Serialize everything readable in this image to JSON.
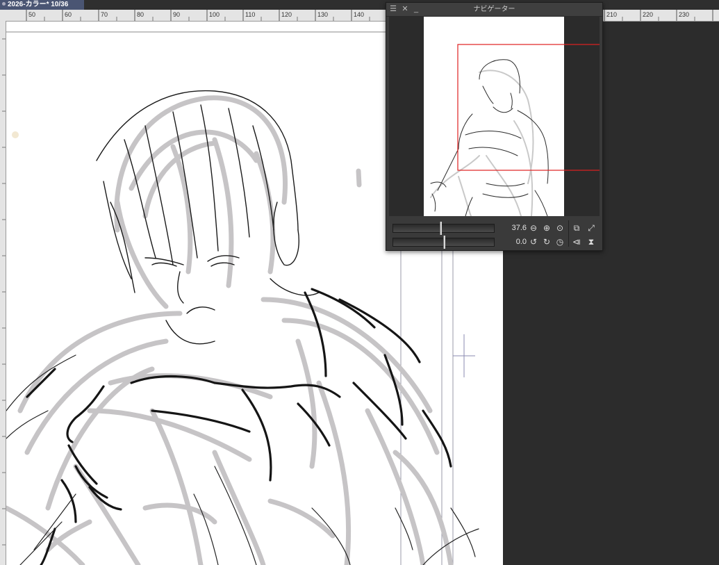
{
  "document_tab": {
    "title": "2026-カラー* 10/36"
  },
  "ruler": {
    "labels": [
      "50",
      "60",
      "70",
      "80",
      "90",
      "100",
      "110",
      "120",
      "130",
      "140",
      "210",
      "220",
      "230"
    ]
  },
  "navigator": {
    "title": "ナビゲーター",
    "zoom_value": "37.6",
    "rotation_value": "0.0",
    "zoom_level": 0.47,
    "rotation_level": 0.5,
    "colors": {
      "view_frame": "#e02020",
      "panel_bg": "#3a3a3a"
    },
    "icons": {
      "menu": "menu-icon",
      "close": "close-icon",
      "minimize": "minimize-icon",
      "zoom_out": "zoom-out-icon",
      "zoom_in": "zoom-in-icon",
      "zoom_reset": "zoom-reset-icon",
      "fit": "fit-to-window-icon",
      "fill": "fill-window-icon",
      "rotate_left": "rotate-left-icon",
      "rotate_right": "rotate-right-icon",
      "rotate_reset": "rotate-reset-icon",
      "flip_h": "flip-horizontal-icon",
      "flip_v": "flip-vertical-icon"
    }
  }
}
